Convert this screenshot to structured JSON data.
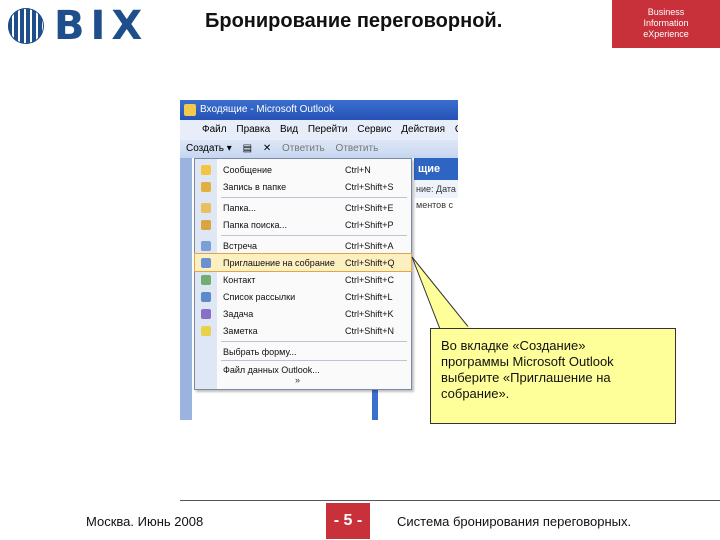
{
  "header": {
    "logo_text": "BIX",
    "title": "Бронирование переговорной.",
    "brand_lines": [
      "Business",
      "Information",
      "eXperience"
    ]
  },
  "outlook": {
    "window_title": "Входящие - Microsoft Outlook",
    "menubar": [
      "Файл",
      "Правка",
      "Вид",
      "Перейти",
      "Сервис",
      "Действия",
      "Сп"
    ],
    "toolbar": {
      "create": "Создать",
      "reply": "Ответить",
      "reply_all": "Ответить"
    },
    "right_pane_title": "щие",
    "right_pane_sub": "ние: Дата",
    "right_pane_sub2": "ментов с",
    "menu_items": [
      {
        "label": "Сообщение",
        "shortcut": "Ctrl+N",
        "icon": "envelope-icon",
        "color": "#f5c542"
      },
      {
        "label": "Запись в папке",
        "shortcut": "Ctrl+Shift+S",
        "icon": "post-icon",
        "color": "#e0b040"
      },
      {
        "label": "Папка...",
        "shortcut": "Ctrl+Shift+E",
        "icon": "folder-icon",
        "color": "#e8c060"
      },
      {
        "label": "Папка поиска...",
        "shortcut": "Ctrl+Shift+P",
        "icon": "search-folder-icon",
        "color": "#d9a441"
      },
      {
        "label": "Встреча",
        "shortcut": "Ctrl+Shift+A",
        "icon": "calendar-icon",
        "color": "#7aa0d6"
      },
      {
        "label": "Приглашение на собрание",
        "shortcut": "Ctrl+Shift+Q",
        "icon": "meeting-icon",
        "color": "#6b8fcf",
        "highlight": true
      },
      {
        "label": "Контакт",
        "shortcut": "Ctrl+Shift+C",
        "icon": "contact-icon",
        "color": "#6fae6f"
      },
      {
        "label": "Список рассылки",
        "shortcut": "Ctrl+Shift+L",
        "icon": "distribution-list-icon",
        "color": "#5d8ac8"
      },
      {
        "label": "Задача",
        "shortcut": "Ctrl+Shift+K",
        "icon": "task-icon",
        "color": "#8a6fc8"
      },
      {
        "label": "Заметка",
        "shortcut": "Ctrl+Shift+N",
        "icon": "note-icon",
        "color": "#e8d24a"
      },
      {
        "label": "Выбрать форму...",
        "shortcut": "",
        "icon": "",
        "color": ""
      },
      {
        "label": "Файл данных Outlook...",
        "shortcut": "",
        "icon": "",
        "color": ""
      }
    ],
    "more_glyph": "»"
  },
  "callout": {
    "lines": [
      "Во вкладке «Создание»",
      "программы Microsoft Outlook",
      "выберите «Приглашение на",
      "собрание»."
    ]
  },
  "footer": {
    "left": "Москва. Июнь 2008",
    "page": "- 5 -",
    "right": "Система бронирования переговорных."
  }
}
